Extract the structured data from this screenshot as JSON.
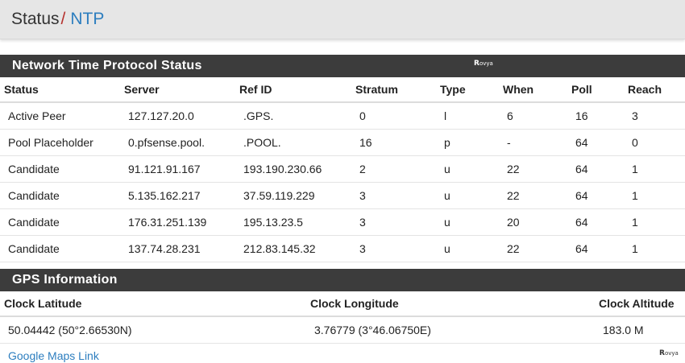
{
  "breadcrumb": {
    "root": "Status",
    "separator": "/",
    "current": "NTP"
  },
  "ntp_panel": {
    "title": "Network Time Protocol Status",
    "columns": [
      "Status",
      "Server",
      "Ref ID",
      "Stratum",
      "Type",
      "When",
      "Poll",
      "Reach"
    ],
    "rows": [
      [
        "Active Peer",
        "127.127.20.0",
        ".GPS.",
        "0",
        "l",
        "6",
        "16",
        "3"
      ],
      [
        "Pool Placeholder",
        "0.pfsense.pool.",
        ".POOL.",
        "16",
        "p",
        "-",
        "64",
        "0"
      ],
      [
        "Candidate",
        "91.121.91.167",
        "193.190.230.66",
        "2",
        "u",
        "22",
        "64",
        "1"
      ],
      [
        "Candidate",
        "5.135.162.217",
        "37.59.119.229",
        "3",
        "u",
        "22",
        "64",
        "1"
      ],
      [
        "Candidate",
        "176.31.251.139",
        "195.13.23.5",
        "3",
        "u",
        "20",
        "64",
        "1"
      ],
      [
        "Candidate",
        "137.74.28.231",
        "212.83.145.32",
        "3",
        "u",
        "22",
        "64",
        "1"
      ]
    ]
  },
  "gps_panel": {
    "title": "GPS Information",
    "columns": [
      "Clock Latitude",
      "Clock Longitude",
      "Clock Altitude"
    ],
    "row": [
      "50.04442 (50°2.66530N)",
      "3.76779 (3°46.06750E)",
      "183.0 M"
    ],
    "maps_link": "Google Maps Link"
  },
  "watermark": {
    "initial": "R",
    "text": "ovya"
  },
  "colors": {
    "header_bg": "#e6e6e6",
    "panel_heading_bg": "#3c3c3c",
    "link": "#2d7ebf",
    "separator": "#b5302c"
  }
}
